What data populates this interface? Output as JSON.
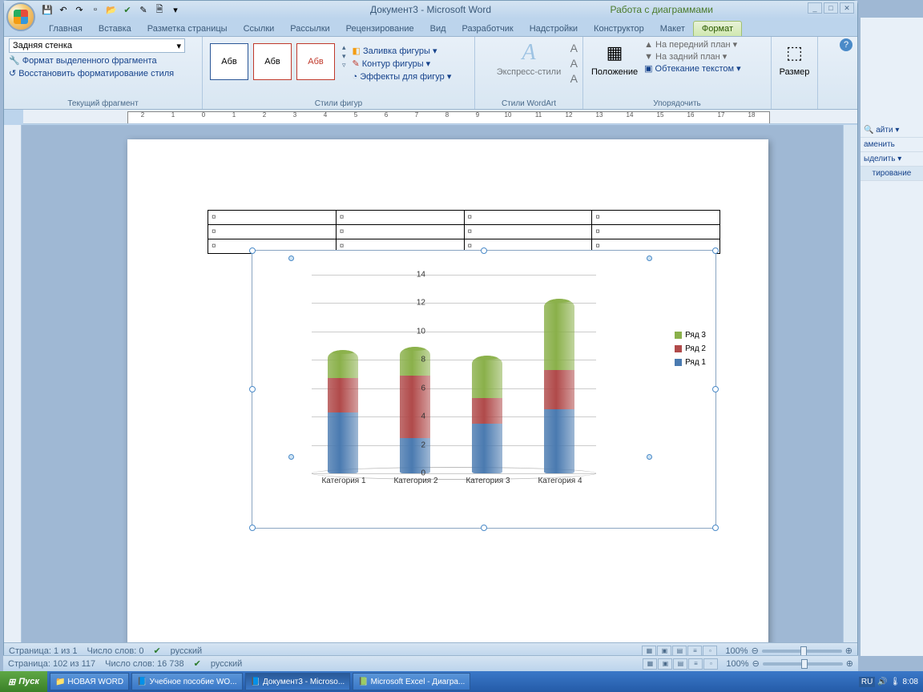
{
  "title": "Документ3 - Microsoft Word",
  "chart_tools_title": "Работа с диаграммами",
  "tabs": [
    "Главная",
    "Вставка",
    "Разметка страницы",
    "Ссылки",
    "Рассылки",
    "Рецензирование",
    "Вид",
    "Разработчик",
    "Надстройки",
    "Конструктор",
    "Макет",
    "Формат"
  ],
  "active_tab": 11,
  "ribbon": {
    "shape_dd": "Задняя стенка",
    "format_sel": "Формат выделенного фрагмента",
    "reset_style": "Восстановить форматирование стиля",
    "group_current": "Текущий фрагмент",
    "style_sample": "Абв",
    "group_styles": "Стили фигур",
    "fill": "Заливка фигуры",
    "outline": "Контур фигуры",
    "effects": "Эффекты для фигур",
    "wa_styles": "Экспресс-стили",
    "group_wa": "Стили WordArt",
    "position": "Положение",
    "bring_front": "На передний план",
    "send_back": "На задний план",
    "text_wrap": "Обтекание текстом",
    "group_arrange": "Упорядочить",
    "size": "Размер"
  },
  "side": {
    "find": "айти",
    "replace": "аменить",
    "select": "ыделить",
    "editing": "тирование"
  },
  "status_inner": {
    "page": "Страница: 1 из 1",
    "words": "Число слов: 0",
    "lang": "русский",
    "zoom": "100%"
  },
  "status_outer": {
    "page": "Страница: 102 из 117",
    "words": "Число слов: 16 738",
    "lang": "русский",
    "zoom": "100%"
  },
  "taskbar": {
    "start": "Пуск",
    "items": [
      "НОВАЯ WORD",
      "Учебное пособие WO...",
      "Документ3 - Microso...",
      "Microsoft Excel - Диагра..."
    ],
    "time": "8:08"
  },
  "chart_data": {
    "type": "bar",
    "stacked": true,
    "categories": [
      "Категория 1",
      "Категория 2",
      "Категория 3",
      "Категория 4"
    ],
    "series": [
      {
        "name": "Ряд 1",
        "color": "#4a7ab0",
        "values": [
          4.3,
          2.5,
          3.5,
          4.5
        ]
      },
      {
        "name": "Ряд 2",
        "color": "#b04a4a",
        "values": [
          2.4,
          4.4,
          1.8,
          2.8
        ]
      },
      {
        "name": "Ряд 3",
        "color": "#8ab04a",
        "values": [
          2.0,
          2.0,
          3.0,
          5.0
        ]
      }
    ],
    "ylim": [
      0,
      14
    ],
    "yticks": [
      0,
      2,
      4,
      6,
      8,
      10,
      12,
      14
    ],
    "legend": [
      "Ряд 3",
      "Ряд 2",
      "Ряд 1"
    ]
  },
  "cell_marker": "¤"
}
